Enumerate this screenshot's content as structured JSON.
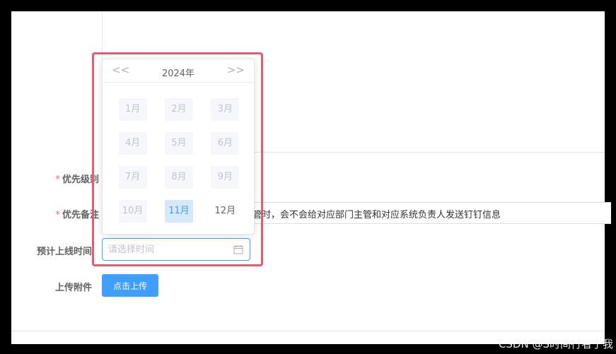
{
  "form": {
    "priority_label": "优先级别",
    "priority_note_label": "优先备注",
    "eta_label": "预计上线时间",
    "attachment_label": "上传附件",
    "required_mark": "*",
    "priority_note_value": "主管时，会不会给对应部门主管和对应系统负责人发送钉钉信息",
    "eta_placeholder": "请选择时间",
    "upload_button": "点击上传"
  },
  "picker": {
    "year": "2024年",
    "prev_label": "<<",
    "next_label": ">>",
    "months": [
      {
        "label": "1月",
        "state": "disabled"
      },
      {
        "label": "2月",
        "state": "disabled"
      },
      {
        "label": "3月",
        "state": "disabled"
      },
      {
        "label": "4月",
        "state": "disabled"
      },
      {
        "label": "5月",
        "state": "disabled"
      },
      {
        "label": "6月",
        "state": "disabled"
      },
      {
        "label": "7月",
        "state": "disabled"
      },
      {
        "label": "8月",
        "state": "disabled"
      },
      {
        "label": "9月",
        "state": "disabled"
      },
      {
        "label": "10月",
        "state": "disabled"
      },
      {
        "label": "11月",
        "state": "current"
      },
      {
        "label": "12月",
        "state": "normal"
      }
    ]
  },
  "colors": {
    "primary": "#409eff",
    "highlight_border": "#e85a71",
    "required": "#f56c6c"
  },
  "watermark": "CSDN @S时间行者于我"
}
